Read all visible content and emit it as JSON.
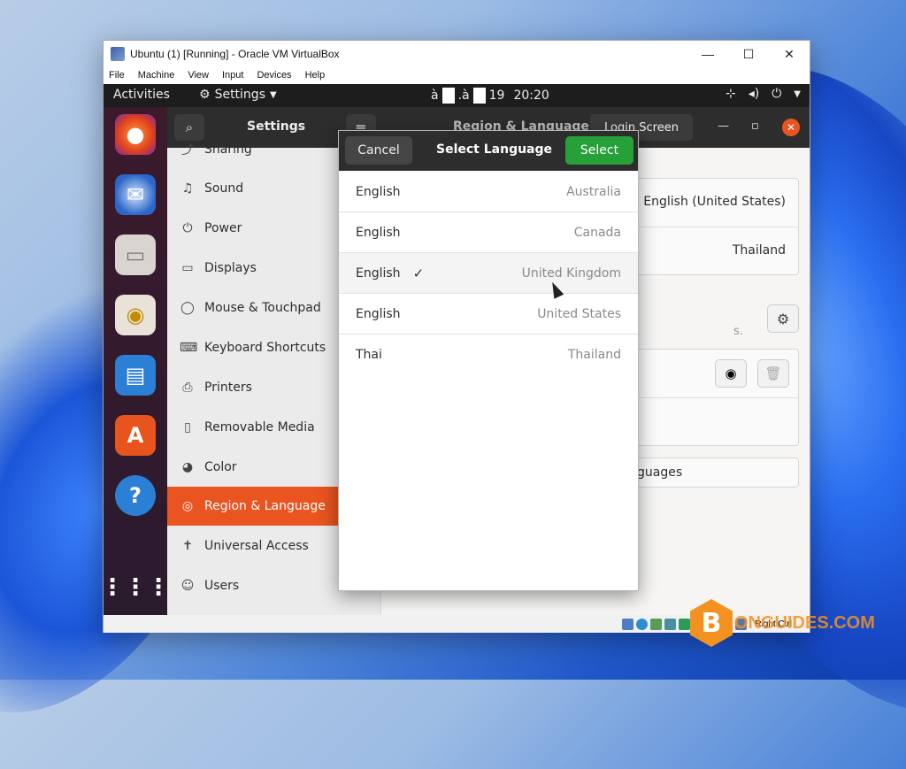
{
  "host": {
    "window_title": "Ubuntu (1) [Running] - Oracle VM VirtualBox",
    "menu": [
      "File",
      "Machine",
      "View",
      "Input",
      "Devices",
      "Help"
    ],
    "status_right": "Right Ctrl"
  },
  "topbar": {
    "activities": "Activities",
    "app_name": "Settings",
    "clock_prefix": "à",
    "clock_mid": ".à",
    "clock_day": "19",
    "clock_time": "20:20"
  },
  "settings": {
    "title": "Settings",
    "panel_title": "Region & Language",
    "login_screen": "Login Screen",
    "sidebar": [
      {
        "icon": "share-icon",
        "glyph": "⤴",
        "label": "Sharing"
      },
      {
        "icon": "music-note-icon",
        "glyph": "♫",
        "label": "Sound"
      },
      {
        "icon": "power-icon",
        "glyph": "⏻",
        "label": "Power"
      },
      {
        "icon": "display-icon",
        "glyph": "▭",
        "label": "Displays"
      },
      {
        "icon": "mouse-icon",
        "glyph": "◯",
        "label": "Mouse & Touchpad"
      },
      {
        "icon": "keyboard-icon",
        "glyph": "⌨",
        "label": "Keyboard Shortcuts"
      },
      {
        "icon": "printer-icon",
        "glyph": "⎙",
        "label": "Printers"
      },
      {
        "icon": "usb-drive-icon",
        "glyph": "▯",
        "label": "Removable Media"
      },
      {
        "icon": "color-icon",
        "glyph": "◕",
        "label": "Color"
      },
      {
        "icon": "globe-icon",
        "glyph": "◎",
        "label": "Region & Language"
      },
      {
        "icon": "accessibility-icon",
        "glyph": "✝",
        "label": "Universal Access"
      },
      {
        "icon": "users-icon",
        "glyph": "☺",
        "label": "Users"
      }
    ],
    "language_value": "English (United States)",
    "formats_value": "Thailand",
    "input_hint": "s.",
    "manage_languages": "guages"
  },
  "dialog": {
    "cancel": "Cancel",
    "title": "Select Language",
    "select": "Select",
    "languages": [
      {
        "name": "English",
        "region": "Australia",
        "checked": false
      },
      {
        "name": "English",
        "region": "Canada",
        "checked": false
      },
      {
        "name": "English",
        "region": "United Kingdom",
        "checked": true
      },
      {
        "name": "English",
        "region": "United States",
        "checked": false
      },
      {
        "name": "Thai",
        "region": "Thailand",
        "checked": false
      }
    ]
  },
  "watermark": {
    "mark": "B",
    "text": "ONGUIDES.COM"
  }
}
